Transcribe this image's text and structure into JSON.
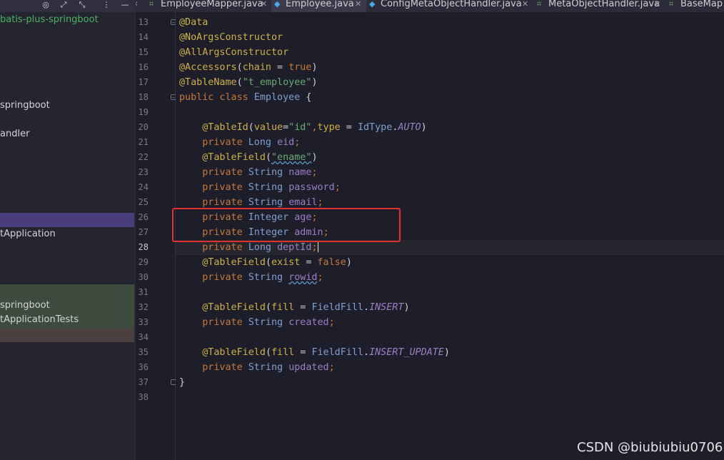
{
  "project_panel": {
    "toolbar_icons": [
      "target-icon",
      "expand-icon",
      "collapse-icon",
      "more-icon",
      "minimize-icon"
    ],
    "items": [
      {
        "label": "batis-plus-springboot",
        "color": "green"
      },
      {
        "label": "springboot"
      },
      {
        "label": "andler"
      },
      {
        "label": "tApplication"
      },
      {
        "label": "springboot"
      },
      {
        "label": "tApplicationTests"
      }
    ]
  },
  "tabs": [
    {
      "label": "EmployeeMapper.java",
      "icon": "mapper-icon"
    },
    {
      "label": "Employee.java",
      "icon": "class-icon",
      "active": true
    },
    {
      "label": "ConfigMetaObjectHandler.java",
      "icon": "class-icon"
    },
    {
      "label": "MetaObjectHandler.java",
      "icon": "interface-icon"
    },
    {
      "label": "BaseMap",
      "icon": "interface-icon"
    }
  ],
  "editor": {
    "current_line": 28,
    "lines": [
      {
        "n": "13",
        "tokens": [
          {
            "t": "@Data",
            "c": "ann"
          }
        ]
      },
      {
        "n": "14",
        "tokens": [
          {
            "t": "@NoArgsConstructor",
            "c": "ann"
          }
        ]
      },
      {
        "n": "15",
        "tokens": [
          {
            "t": "@AllArgsConstructor",
            "c": "ann"
          }
        ]
      },
      {
        "n": "16",
        "tokens": [
          {
            "t": "@Accessors",
            "c": "ann"
          },
          {
            "t": "(",
            "c": "pl"
          },
          {
            "t": "chain",
            "c": "ann"
          },
          {
            "t": " = ",
            "c": "pl"
          },
          {
            "t": "true",
            "c": "kw"
          },
          {
            "t": ")",
            "c": "pl"
          }
        ]
      },
      {
        "n": "17",
        "tokens": [
          {
            "t": "@TableName",
            "c": "ann"
          },
          {
            "t": "(",
            "c": "pl"
          },
          {
            "t": "\"t_employee\"",
            "c": "str"
          },
          {
            "t": ")",
            "c": "pl"
          }
        ]
      },
      {
        "n": "18",
        "tokens": [
          {
            "t": "public class ",
            "c": "kw"
          },
          {
            "t": "Employee",
            "c": "typ"
          },
          {
            "t": " {",
            "c": "pl"
          }
        ]
      },
      {
        "n": "19",
        "tokens": []
      },
      {
        "n": "20",
        "tokens": [
          {
            "t": "    @TableId",
            "c": "ann"
          },
          {
            "t": "(",
            "c": "pl"
          },
          {
            "t": "value",
            "c": "ann"
          },
          {
            "t": "=",
            "c": "pl"
          },
          {
            "t": "\"id\"",
            "c": "str"
          },
          {
            "t": ",",
            "c": "kw"
          },
          {
            "t": "type",
            "c": "ann"
          },
          {
            "t": " = ",
            "c": "pl"
          },
          {
            "t": "IdType",
            "c": "typ"
          },
          {
            "t": ".",
            "c": "pl"
          },
          {
            "t": "AUTO",
            "c": "cst"
          },
          {
            "t": ")",
            "c": "pl"
          }
        ]
      },
      {
        "n": "21",
        "tokens": [
          {
            "t": "    private ",
            "c": "kw"
          },
          {
            "t": "Long ",
            "c": "typ"
          },
          {
            "t": "eid",
            "c": "fld"
          },
          {
            "t": ";",
            "c": "kw"
          }
        ]
      },
      {
        "n": "22",
        "tokens": [
          {
            "t": "    @TableField",
            "c": "ann"
          },
          {
            "t": "(",
            "c": "pl"
          },
          {
            "t": "\"ename\"",
            "c": "str",
            "squig": true
          },
          {
            "t": ")",
            "c": "pl"
          }
        ]
      },
      {
        "n": "23",
        "tokens": [
          {
            "t": "    private ",
            "c": "kw"
          },
          {
            "t": "String ",
            "c": "typ"
          },
          {
            "t": "name",
            "c": "fld"
          },
          {
            "t": ";",
            "c": "kw"
          }
        ]
      },
      {
        "n": "24",
        "tokens": [
          {
            "t": "    private ",
            "c": "kw"
          },
          {
            "t": "String ",
            "c": "typ"
          },
          {
            "t": "password",
            "c": "fld"
          },
          {
            "t": ";",
            "c": "kw"
          }
        ]
      },
      {
        "n": "25",
        "tokens": [
          {
            "t": "    private ",
            "c": "kw"
          },
          {
            "t": "String ",
            "c": "typ"
          },
          {
            "t": "email",
            "c": "fld"
          },
          {
            "t": ";",
            "c": "kw"
          }
        ]
      },
      {
        "n": "26",
        "tokens": [
          {
            "t": "    private ",
            "c": "kw"
          },
          {
            "t": "Integer ",
            "c": "typ"
          },
          {
            "t": "age",
            "c": "fld"
          },
          {
            "t": ";",
            "c": "kw"
          }
        ]
      },
      {
        "n": "27",
        "tokens": [
          {
            "t": "    private ",
            "c": "kw"
          },
          {
            "t": "Integer ",
            "c": "typ"
          },
          {
            "t": "admin",
            "c": "fld"
          },
          {
            "t": ";",
            "c": "kw"
          }
        ]
      },
      {
        "n": "28",
        "tokens": [
          {
            "t": "    private ",
            "c": "kw"
          },
          {
            "t": "Long ",
            "c": "typ"
          },
          {
            "t": "deptId",
            "c": "fld"
          },
          {
            "t": ";",
            "c": "kw"
          }
        ]
      },
      {
        "n": "29",
        "tokens": [
          {
            "t": "    @TableField",
            "c": "ann"
          },
          {
            "t": "(",
            "c": "pl"
          },
          {
            "t": "exist",
            "c": "ann"
          },
          {
            "t": " = ",
            "c": "pl"
          },
          {
            "t": "false",
            "c": "kw"
          },
          {
            "t": ")",
            "c": "pl"
          }
        ]
      },
      {
        "n": "30",
        "tokens": [
          {
            "t": "    private ",
            "c": "kw"
          },
          {
            "t": "String ",
            "c": "typ"
          },
          {
            "t": "rowid",
            "c": "fld",
            "squig": true
          },
          {
            "t": ";",
            "c": "kw"
          }
        ]
      },
      {
        "n": "31",
        "tokens": []
      },
      {
        "n": "32",
        "tokens": [
          {
            "t": "    @TableField",
            "c": "ann"
          },
          {
            "t": "(",
            "c": "pl"
          },
          {
            "t": "fill",
            "c": "ann"
          },
          {
            "t": " = ",
            "c": "pl"
          },
          {
            "t": "FieldFill",
            "c": "typ"
          },
          {
            "t": ".",
            "c": "pl"
          },
          {
            "t": "INSERT",
            "c": "cst"
          },
          {
            "t": ")",
            "c": "pl"
          }
        ]
      },
      {
        "n": "33",
        "tokens": [
          {
            "t": "    private ",
            "c": "kw"
          },
          {
            "t": "String ",
            "c": "typ"
          },
          {
            "t": "created",
            "c": "fld"
          },
          {
            "t": ";",
            "c": "kw"
          }
        ]
      },
      {
        "n": "34",
        "tokens": []
      },
      {
        "n": "35",
        "tokens": [
          {
            "t": "    @TableField",
            "c": "ann"
          },
          {
            "t": "(",
            "c": "pl"
          },
          {
            "t": "fill",
            "c": "ann"
          },
          {
            "t": " = ",
            "c": "pl"
          },
          {
            "t": "FieldFill",
            "c": "typ"
          },
          {
            "t": ".",
            "c": "pl"
          },
          {
            "t": "INSERT_UPDATE",
            "c": "cst"
          },
          {
            "t": ")",
            "c": "pl"
          }
        ]
      },
      {
        "n": "36",
        "tokens": [
          {
            "t": "    private ",
            "c": "kw"
          },
          {
            "t": "String ",
            "c": "typ"
          },
          {
            "t": "updated",
            "c": "fld"
          },
          {
            "t": ";",
            "c": "kw"
          }
        ]
      },
      {
        "n": "37",
        "tokens": [
          {
            "t": "}",
            "c": "pl"
          }
        ]
      },
      {
        "n": "38",
        "tokens": []
      }
    ]
  },
  "highlight_color": "#e0332f",
  "watermark": "CSDN @biubiubiu0706"
}
